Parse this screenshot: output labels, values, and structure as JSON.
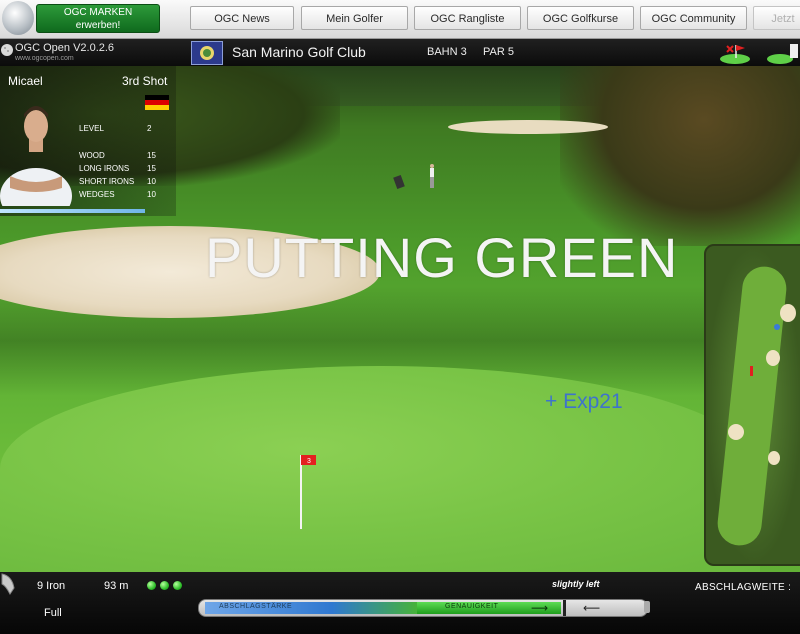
{
  "topbar": {
    "marken_line1": "OGC MARKEN",
    "marken_line2": "erwerben!",
    "nav": [
      {
        "label": "OGC News"
      },
      {
        "label": "Mein Golfer"
      },
      {
        "label": "OGC Rangliste"
      },
      {
        "label": "OGC Golfkurse"
      },
      {
        "label": "OGC Community"
      },
      {
        "label": "Jetzt"
      }
    ]
  },
  "infobar": {
    "version": "OGC Open V2.0.2.6",
    "website": "www.ogcopen.com",
    "club_name": "San Marino Golf Club",
    "hole": "BAHN 3",
    "par": "PAR 5"
  },
  "player": {
    "name": "Micael",
    "shot": "3rd Shot",
    "country_flag": "germany",
    "level_label": "LEVEL",
    "level_value": "2",
    "stats": [
      {
        "label": "WOOD",
        "value": "15"
      },
      {
        "label": "LONG IRONS",
        "value": "15"
      },
      {
        "label": "SHORT IRONS",
        "value": "10"
      },
      {
        "label": "WEDGES",
        "value": "10"
      }
    ]
  },
  "scene": {
    "title": "PUTTING GREEN",
    "exp": "+ Exp21",
    "pin_number": "3"
  },
  "hud": {
    "club": "9 Iron",
    "distance": "93 m",
    "wind": "slightly left",
    "abschlagweite": "ABSCHLAGWEITE :",
    "swing_mode": "Full",
    "meter_power_label": "ABSCHLAGSTÄRKE",
    "meter_accuracy_label": "GENAUIGKEIT"
  },
  "colors": {
    "accent_green": "#1f9d1d",
    "exp_blue": "#3e73cc",
    "power_blue": "#2f78d0"
  }
}
